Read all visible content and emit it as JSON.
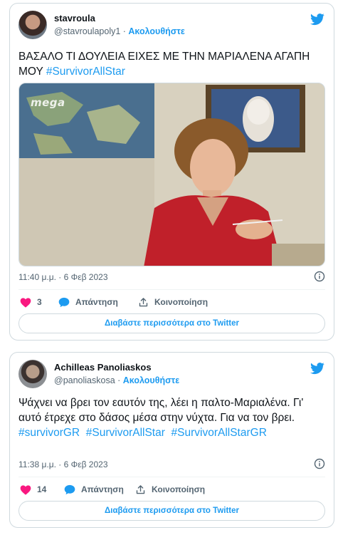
{
  "tweets": [
    {
      "author_name": "stavroula",
      "handle": "@stavroulapoly1",
      "separator": " · ",
      "follow_label": "Ακολουθήστε",
      "text": "ΒΑΣΑΛΟ ΤΙ ΔΟΥΛΕΙΑ ΕΙΧΕΣ ΜΕ ΤΗΝ ΜΑΡΙΑΛΕΝΑ ΑΓΑΠΗ ΜΟΥ ",
      "hashtags": [
        "#SurvivorAllStar"
      ],
      "media_logo": "mega",
      "timestamp": "11:40 μ.μ. · 6 Φεβ 2023",
      "likes": "3",
      "reply_label": "Απάντηση",
      "share_label": "Κοινοποίηση",
      "read_more": "Διαβάστε περισσότερα στο Twitter"
    },
    {
      "author_name": "Achilleas Panoliaskos",
      "handle": "@panoliaskosa",
      "separator": " · ",
      "follow_label": "Ακολουθήστε",
      "text": "Ψάχνει να βρει τον εαυτόν της, λέει η παλτο-Μαριαλένα. Γι' αυτό έτρεχε στο δάσος μέσα στην νύχτα. Για να τον βρει.",
      "hashtags": [
        "#survivorGR",
        "#SurvivorAllStar",
        "#SurvivorAllStarGR"
      ],
      "timestamp": "11:38 μ.μ. · 6 Φεβ 2023",
      "likes": "14",
      "reply_label": "Απάντηση",
      "share_label": "Κοινοποίηση",
      "read_more": "Διαβάστε περισσότερα στο Twitter"
    }
  ],
  "colors": {
    "twitter_blue": "#1d9bf0",
    "like_pink": "#f91880",
    "text": "#0f1419",
    "muted": "#536471",
    "border": "#cfd9de"
  },
  "icons": [
    "twitter-bird-icon",
    "heart-icon",
    "reply-bubble-icon",
    "share-icon",
    "info-icon"
  ]
}
